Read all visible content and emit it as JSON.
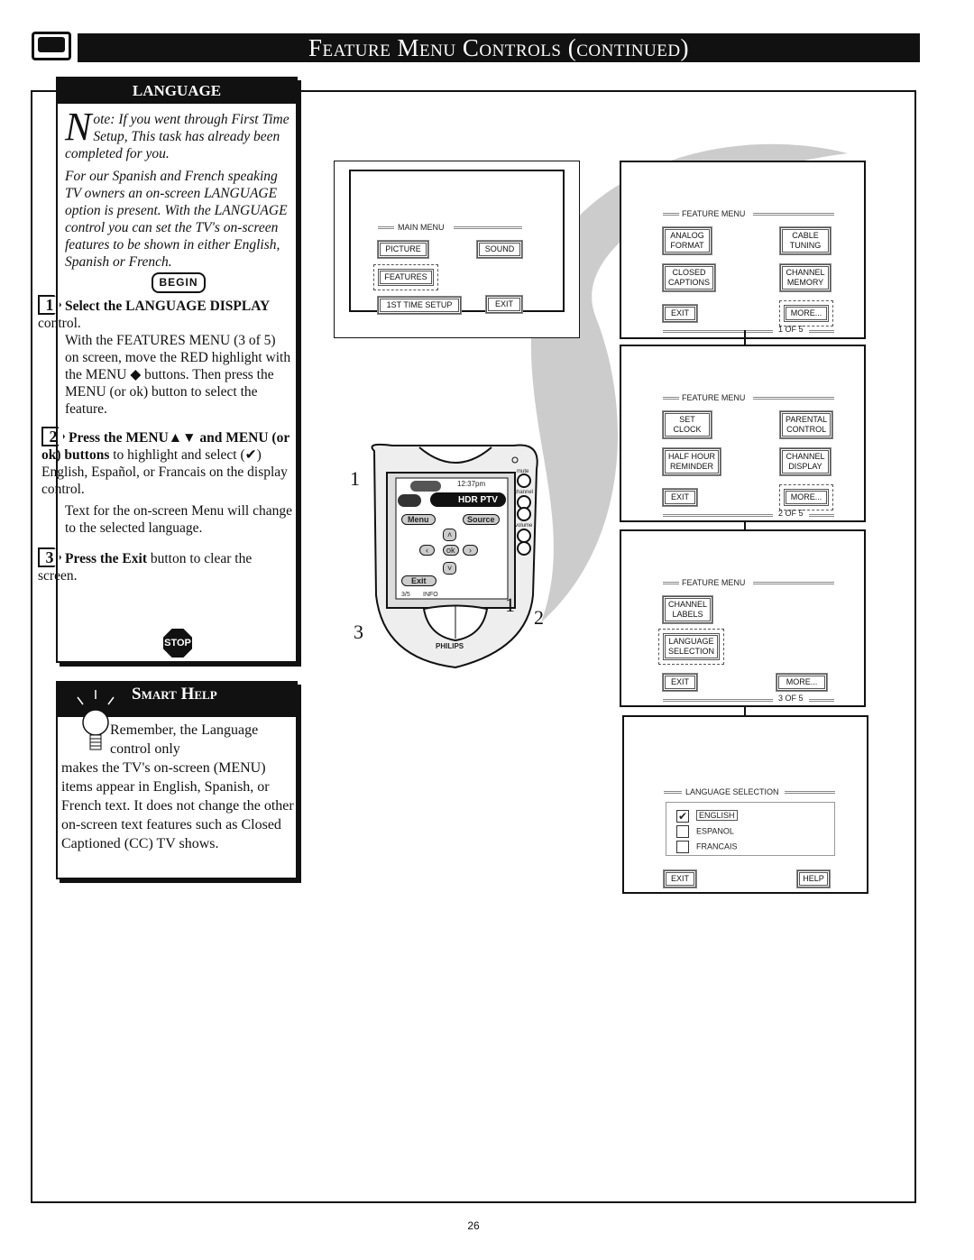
{
  "header": {
    "title": "Feature Menu Controls (continued)",
    "tv_icon": "tv-icon"
  },
  "language": {
    "title": "LANGUAGE",
    "note_dropcap": "N",
    "note": "ote: If you went through First Time Setup, This task has already been completed for you.",
    "intro": "For our Spanish and French speaking TV owners an on-screen LANGUAGE option is present. With the LANGUAGE control you can set the TV's on-screen features to be shown in either English, Spanish or French.",
    "begin": "BEGIN",
    "steps": [
      {
        "num": "1",
        "bold": "Select the LANGUAGE DISPLAY",
        "rest": " control.",
        "body": "With the FEATURES MENU (3 of 5) on screen, move the RED highlight with the MENU ◆ buttons. Then press the MENU (or ok) button to select the feature."
      },
      {
        "num": "2",
        "bold": "Press the MENU▲▼ and MENU (or ok) buttons",
        "rest": " to highlight and select (✔) English, Español, or Francais on the display control.",
        "body": "Text for the on-screen Menu will change to the selected language."
      },
      {
        "num": "3",
        "bold": "Press the Exit",
        "rest": " button to clear the screen.",
        "body": ""
      }
    ],
    "stop": "STOP"
  },
  "smart_help": {
    "title": "Smart Help",
    "text_indent": "Remember, the Language control only",
    "text": "makes the TV's on-screen (MENU) items appear in English, Spanish, or French text. It does not change the other on-screen text features such as Closed Captioned (CC) TV shows."
  },
  "main_menu": {
    "title": "MAIN MENU",
    "buttons": [
      "PICTURE",
      "SOUND",
      "FEATURES",
      "1ST TIME SETUP",
      "EXIT"
    ]
  },
  "remote": {
    "time": "12:37pm",
    "device": "HDR PTV",
    "menu": "Menu",
    "source": "Source",
    "ok": "ok",
    "exit": "Exit",
    "page": "3/5",
    "info": "INFO",
    "mute": "mute",
    "channel": "channel",
    "volume": "volume",
    "brand": "PHILIPS",
    "callouts": [
      "1",
      "3",
      "1",
      "2"
    ]
  },
  "feature_menus": [
    {
      "title": "FEATURE MENU",
      "left": [
        "ANALOG\nFORMAT",
        "CLOSED\nCAPTIONS",
        "EXIT"
      ],
      "right": [
        "CABLE\nTUNING",
        "CHANNEL\nMEMORY",
        "MORE..."
      ],
      "page": "1 OF 5"
    },
    {
      "title": "FEATURE MENU",
      "left": [
        "SET\nCLOCK",
        "HALF HOUR\nREMINDER",
        "EXIT"
      ],
      "right": [
        "PARENTAL\nCONTROL",
        "CHANNEL\nDISPLAY",
        "MORE..."
      ],
      "page": "2 OF 5"
    },
    {
      "title": "FEATURE MENU",
      "left": [
        "CHANNEL\nLABELS",
        "LANGUAGE\nSELECTION",
        "EXIT"
      ],
      "right": [
        "MORE..."
      ],
      "page": "3 OF 5"
    }
  ],
  "language_selection": {
    "title": "LANGUAGE SELECTION",
    "options": [
      {
        "label": "ENGLISH",
        "checked": true
      },
      {
        "label": "ESPANOL",
        "checked": false
      },
      {
        "label": "FRANCAIS",
        "checked": false
      }
    ],
    "exit": "EXIT",
    "help": "HELP"
  },
  "page_number": "26"
}
